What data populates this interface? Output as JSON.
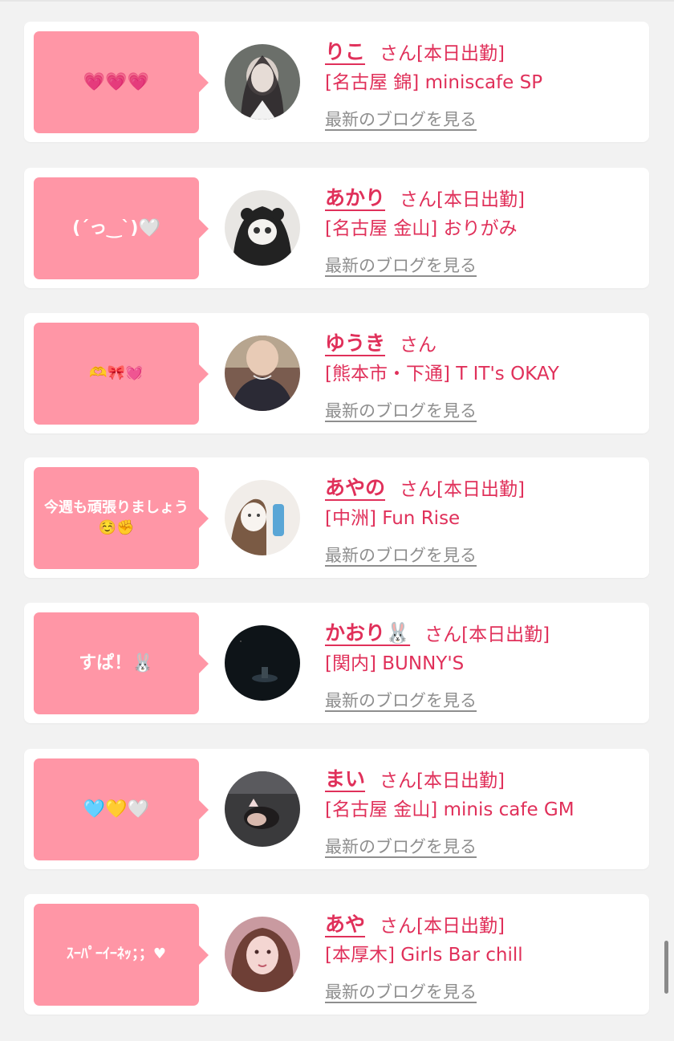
{
  "entries": [
    {
      "message": "💗💗💗",
      "name": "りこ",
      "suffix": "さん",
      "status": "[本日出勤]",
      "shop": "[名古屋 錦] miniscafe SP",
      "blog": "最新のブログを見る"
    },
    {
      "message": "(ˊっ‿ˋ)🤍",
      "name": "あかり",
      "suffix": "さん",
      "status": "[本日出勤]",
      "shop": "[名古屋 金山] おりがみ",
      "blog": "最新のブログを見る"
    },
    {
      "message": "🫶🎀💓",
      "name": "ゆうき",
      "suffix": "さん",
      "status": "",
      "shop": "[熊本市・下通] T IT's OKAY",
      "blog": "最新のブログを見る"
    },
    {
      "message": "今週も頑張りましょう☺️✊",
      "name": "あやの",
      "suffix": "さん",
      "status": "[本日出勤]",
      "shop": "[中洲] Fun Rise",
      "blog": "最新のブログを見る"
    },
    {
      "message": "すぱ！🐰",
      "name": "かおり🐰",
      "suffix": "さん",
      "status": "[本日出勤]",
      "shop": "[関内] BUNNY'S",
      "blog": "最新のブログを見る"
    },
    {
      "message": "🩵💛🤍",
      "name": "まい",
      "suffix": "さん",
      "status": "[本日出勤]",
      "shop": "[名古屋 金山] minis cafe GM",
      "blog": "最新のブログを見る"
    },
    {
      "message": "ｽｰﾊﾟｰｲｰﾈｯ；；♥",
      "name": "あや",
      "suffix": "さん",
      "status": "[本日出勤]",
      "shop": "[本厚木] Girls Bar chill",
      "blog": "最新のブログを見る"
    }
  ],
  "colors": {
    "accent": "#e0305a",
    "bubble": "#ff96a6",
    "link_gray": "#8e8e8e",
    "background": "#f2f2f2"
  }
}
